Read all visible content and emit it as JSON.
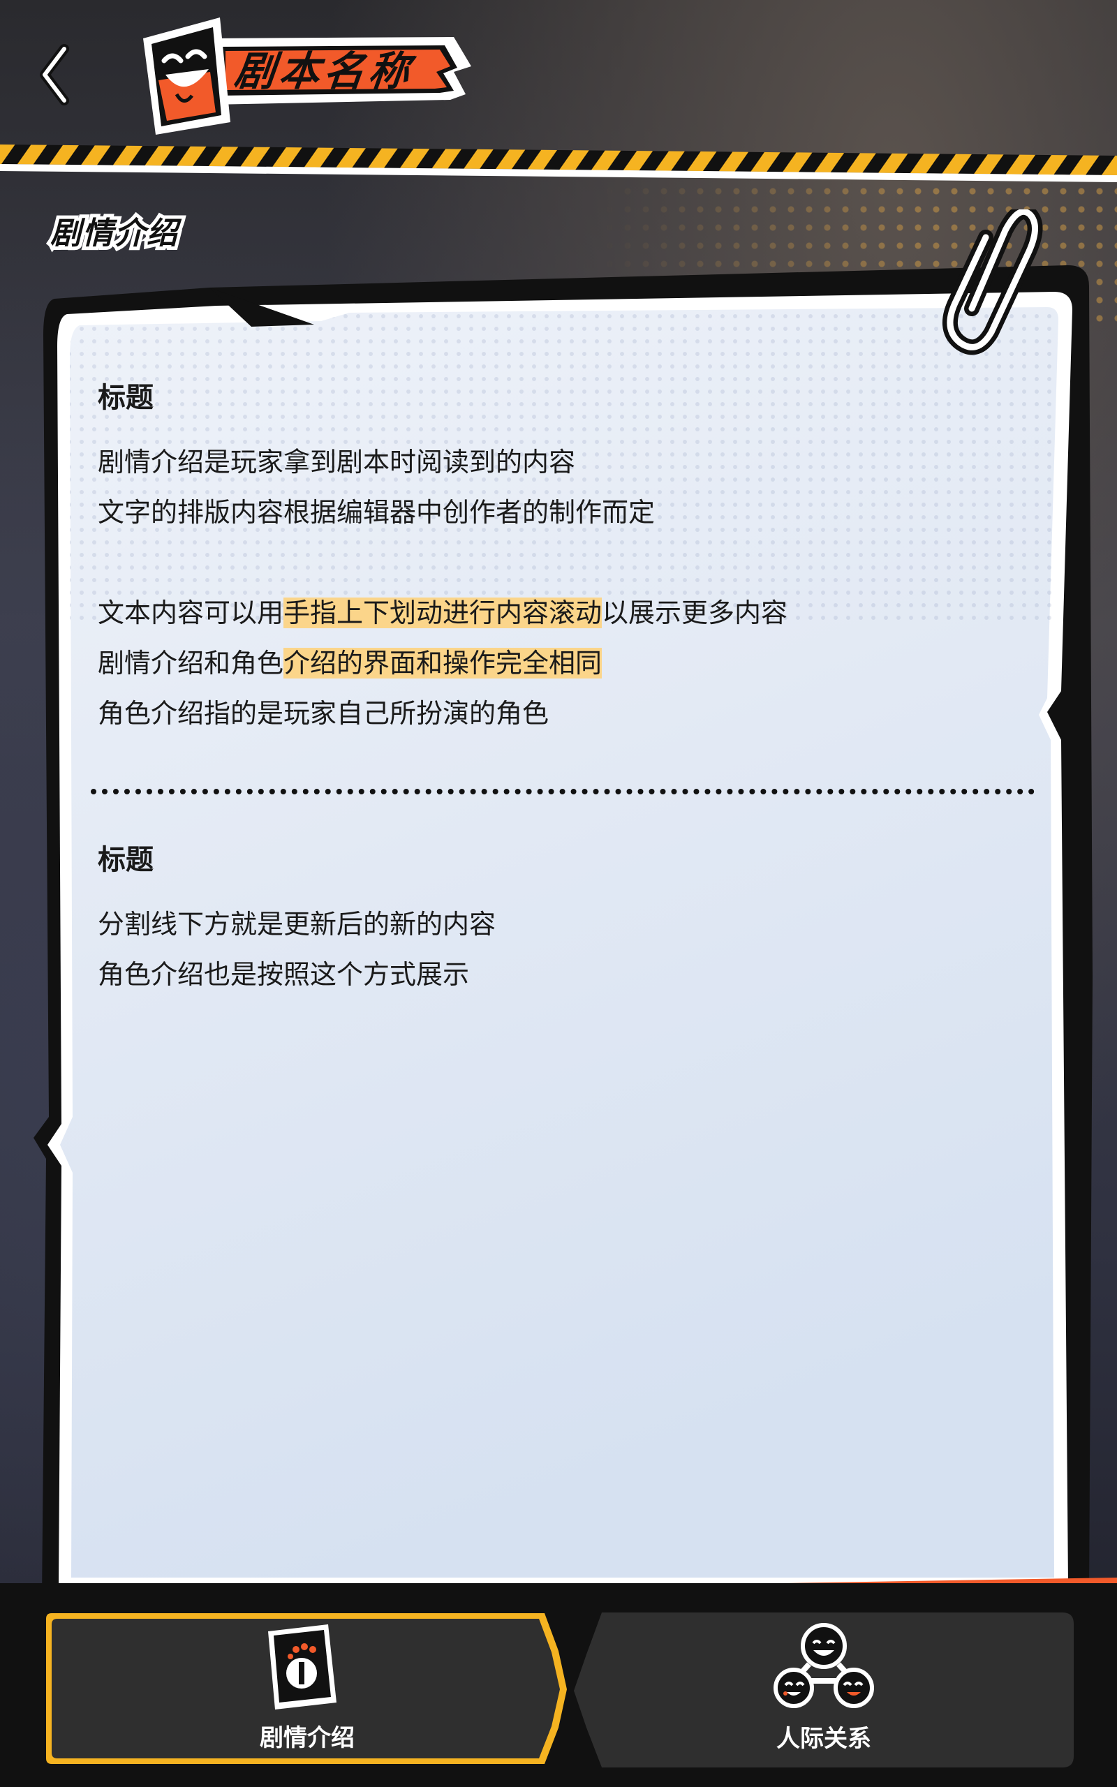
{
  "header": {
    "back_icon": "chevron-left-icon",
    "title": "剧本名称",
    "badge_icon": "grinning-mask-card-icon"
  },
  "section_label": "剧情介绍",
  "document": {
    "blocks": [
      {
        "heading": "标题",
        "lines": [
          {
            "parts": [
              {
                "text": "剧情介绍是玩家拿到剧本时阅读到的内容",
                "highlight": false
              }
            ]
          },
          {
            "parts": [
              {
                "text": "文字的排版内容根据编辑器中创作者的制作而定",
                "highlight": false
              }
            ]
          },
          {
            "parts": []
          },
          {
            "parts": [
              {
                "text": "文本内容可以用",
                "highlight": false
              },
              {
                "text": "手指上下划动进行内容滚动",
                "highlight": true
              },
              {
                "text": "以展示更多内容",
                "highlight": false
              }
            ]
          },
          {
            "parts": [
              {
                "text": "剧情介绍和角色",
                "highlight": false
              },
              {
                "text": "介绍的界面和操作完全相同",
                "highlight": true
              }
            ]
          },
          {
            "parts": [
              {
                "text": "角色介绍指的是玩家自己所扮演的角色",
                "highlight": false
              }
            ]
          }
        ]
      },
      {
        "heading": "标题",
        "lines": [
          {
            "parts": [
              {
                "text": "分割线下方就是更新后的新的内容",
                "highlight": false
              }
            ]
          },
          {
            "parts": [
              {
                "text": "角色介绍也是按照这个方式展示",
                "highlight": false
              }
            ]
          }
        ]
      }
    ]
  },
  "tabs": [
    {
      "label": "剧情介绍",
      "icon": "mask-card-icon",
      "active": true
    },
    {
      "label": "人际关系",
      "icon": "relationship-faces-icon",
      "active": false
    }
  ],
  "colors": {
    "accent_orange": "#f25a2a",
    "accent_yellow": "#f5b321",
    "highlight": "#fbd58a",
    "paper": "#e4ebf6",
    "tab_bg": "#2b2b2b"
  }
}
